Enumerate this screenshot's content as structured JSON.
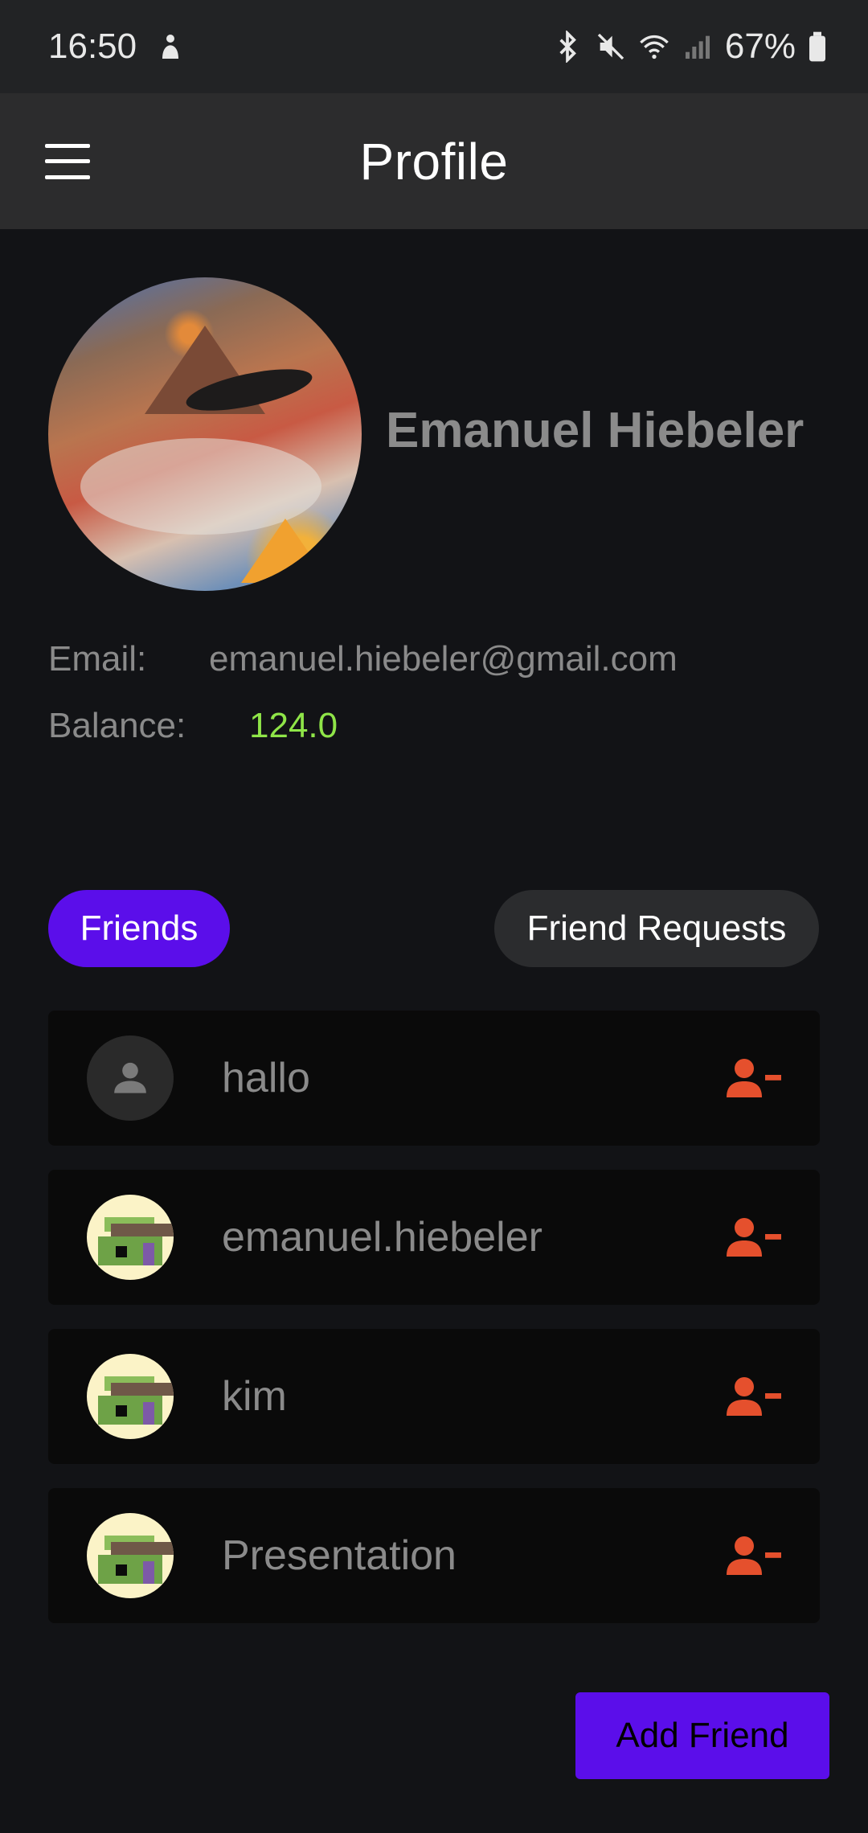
{
  "status_bar": {
    "time": "16:50",
    "battery": "67%",
    "icons": [
      "notification-icon",
      "bluetooth-icon",
      "mute-icon",
      "wifi-icon",
      "signal-icon",
      "battery-icon"
    ]
  },
  "app_bar": {
    "title": "Profile",
    "menu_icon": "menu-icon"
  },
  "profile": {
    "name": "Emanuel Hiebeler",
    "email_label": "Email:",
    "email": "emanuel.hiebeler@gmail.com",
    "balance_label": "Balance:",
    "balance": "124.0"
  },
  "tabs": [
    {
      "label": "Friends",
      "active": true
    },
    {
      "label": "Friend Requests",
      "active": false
    }
  ],
  "friends": [
    {
      "name": "hallo",
      "avatar": "default-person-icon"
    },
    {
      "name": "emanuel.hiebeler",
      "avatar": "pixel-avatar"
    },
    {
      "name": "kim",
      "avatar": "pixel-avatar"
    },
    {
      "name": "Presentation",
      "avatar": "pixel-avatar"
    }
  ],
  "actions": {
    "add_friend_label": "Add Friend",
    "remove_icon": "remove-friend-icon"
  },
  "colors": {
    "accent": "#5b0eea",
    "balance": "#8fe548",
    "remove": "#e5502d",
    "background": "#121316"
  }
}
